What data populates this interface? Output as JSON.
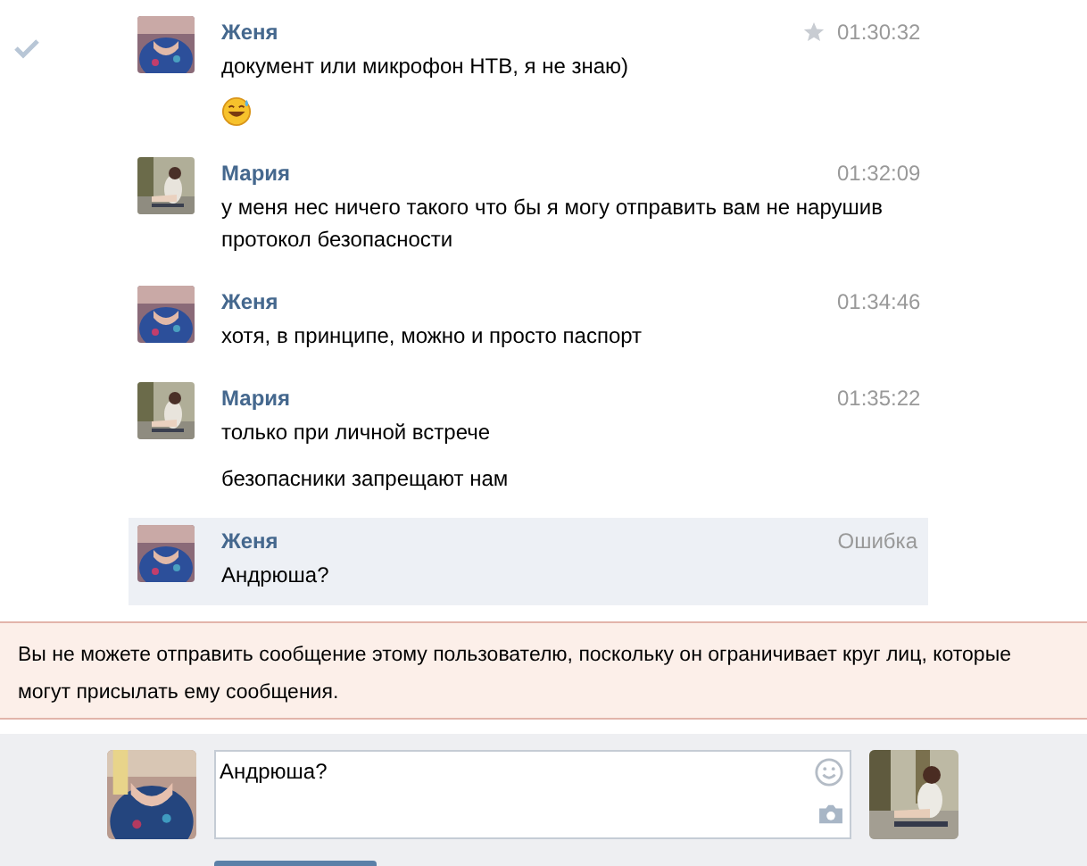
{
  "messages": [
    {
      "author": "Женя",
      "time": "01:30:32",
      "starred": true,
      "checked": true,
      "failed": false,
      "lines": [
        {
          "kind": "text",
          "text": "документ или микрофон НТВ, я не знаю)"
        },
        {
          "kind": "emoji"
        }
      ]
    },
    {
      "author": "Мария",
      "time": "01:32:09",
      "starred": false,
      "checked": false,
      "failed": false,
      "lines": [
        {
          "kind": "text",
          "text": "у меня нес ничего такого что бы я могу отправить вам не нарушив протокол безопасности"
        }
      ]
    },
    {
      "author": "Женя",
      "time": "01:34:46",
      "starred": false,
      "checked": false,
      "failed": false,
      "lines": [
        {
          "kind": "text",
          "text": "хотя, в принципе, можно и просто паспорт"
        }
      ]
    },
    {
      "author": "Мария",
      "time": "01:35:22",
      "starred": false,
      "checked": false,
      "failed": false,
      "lines": [
        {
          "kind": "text",
          "text": "только при личной встрече"
        },
        {
          "kind": "text",
          "text": "безопасники запрещают нам"
        }
      ]
    },
    {
      "author": "Женя",
      "time": "Ошибка",
      "starred": false,
      "checked": false,
      "failed": true,
      "lines": [
        {
          "kind": "text",
          "text": "Андрюша?"
        }
      ]
    }
  ],
  "notice": "Вы не можете отправить сообщение этому пользователю, поскольку он ограничивает круг лиц, которые могут присылать ему сообщения.",
  "composer": {
    "value": "Андрюша?"
  }
}
